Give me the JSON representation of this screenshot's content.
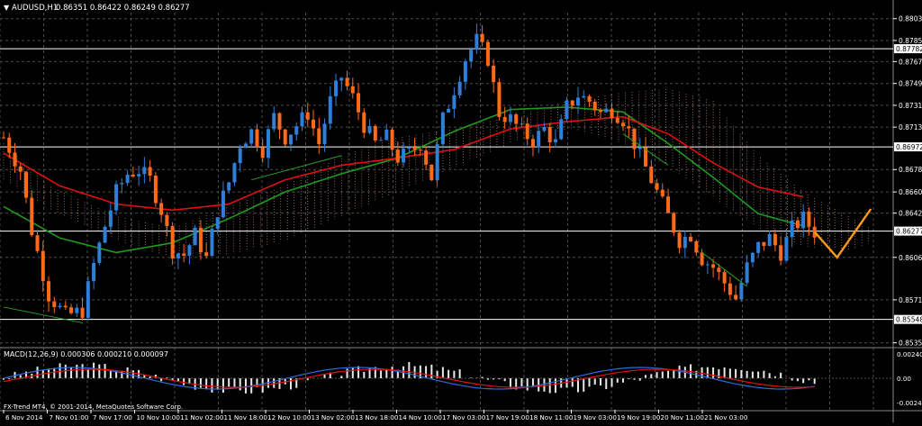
{
  "header": {
    "symbol": "AUDUSD,H1",
    "ohlc": "0.86351 0.86422 0.86249 0.86277"
  },
  "macd_header": {
    "label": "MACD(12,26,9) 0.000306 0.000210 0.000097"
  },
  "copyright": "FX-Trend MT4, © 2001-2014, MetaQuotes Software Corp.",
  "colors": {
    "background": "#000000",
    "grid": "#4a4a4a",
    "bull": "#2f7fd8",
    "bear": "#ff6a1a",
    "ma_red": "#e01010",
    "ma_green": "#1f9a1f",
    "cloud": "#e8b090",
    "trendline": "#2aa02a",
    "projection": "#ff9a1a",
    "text": "#ffffff"
  },
  "chart_data": [
    {
      "type": "candlestick",
      "title": "AUDUSD,H1",
      "ylim": [
        0.8533,
        0.8808
      ],
      "y_ticks": [
        "0.88030",
        "0.87850",
        "0.87676",
        "0.87495",
        "0.87315",
        "0.87135",
        "0.86785",
        "0.86600",
        "0.86425",
        "0.86060",
        "0.85710",
        "0.85355"
      ],
      "x_ticks": [
        "6 Nov 2014",
        "7 Nov 01:00",
        "7 Nov 17:00",
        "10 Nov 10:00",
        "11 Nov 02:00",
        "11 Nov 18:00",
        "12 Nov 10:00",
        "13 Nov 02:00",
        "13 Nov 18:00",
        "14 Nov 10:00",
        "17 Nov 03:00",
        "17 Nov 19:00",
        "18 Nov 11:00",
        "19 Nov 03:00",
        "19 Nov 19:00",
        "20 Nov 11:00",
        "21 Nov 03:00"
      ],
      "horizontal_levels": [
        "0.87782",
        "0.86972",
        "0.86277",
        "0.85548"
      ],
      "close_path": [
        [
          0,
          0.8705
        ],
        [
          3,
          0.8678
        ],
        [
          5,
          0.8628
        ],
        [
          8,
          0.8575
        ],
        [
          11,
          0.8558
        ],
        [
          14,
          0.8562
        ],
        [
          16,
          0.86
        ],
        [
          18,
          0.8632
        ],
        [
          20,
          0.866
        ],
        [
          22,
          0.8675
        ],
        [
          24,
          0.8678
        ],
        [
          26,
          0.867
        ],
        [
          28,
          0.8645
        ],
        [
          30,
          0.8612
        ],
        [
          32,
          0.8608
        ],
        [
          34,
          0.8625
        ],
        [
          36,
          0.8605
        ],
        [
          38,
          0.8645
        ],
        [
          40,
          0.8668
        ],
        [
          42,
          0.87
        ],
        [
          44,
          0.871
        ],
        [
          46,
          0.8695
        ],
        [
          48,
          0.8722
        ],
        [
          50,
          0.8705
        ],
        [
          52,
          0.8715
        ],
        [
          54,
          0.8725
        ],
        [
          56,
          0.87
        ],
        [
          58,
          0.8735
        ],
        [
          60,
          0.8755
        ],
        [
          62,
          0.8738
        ],
        [
          64,
          0.8715
        ],
        [
          66,
          0.87
        ],
        [
          68,
          0.8705
        ],
        [
          70,
          0.8688
        ],
        [
          72,
          0.8692
        ],
        [
          74,
          0.87
        ],
        [
          76,
          0.8672
        ],
        [
          78,
          0.872
        ],
        [
          80,
          0.8745
        ],
        [
          82,
          0.877
        ],
        [
          84,
          0.8785
        ],
        [
          86,
          0.877
        ],
        [
          88,
          0.8725
        ],
        [
          90,
          0.872
        ],
        [
          92,
          0.871
        ],
        [
          94,
          0.8702
        ],
        [
          96,
          0.8712
        ],
        [
          98,
          0.87
        ],
        [
          100,
          0.873
        ],
        [
          102,
          0.874
        ],
        [
          104,
          0.8735
        ],
        [
          106,
          0.8725
        ],
        [
          108,
          0.8728
        ],
        [
          110,
          0.872
        ],
        [
          112,
          0.87
        ],
        [
          114,
          0.868
        ],
        [
          116,
          0.866
        ],
        [
          118,
          0.864
        ],
        [
          120,
          0.862
        ],
        [
          122,
          0.8625
        ],
        [
          124,
          0.8605
        ],
        [
          126,
          0.8598
        ],
        [
          128,
          0.8585
        ],
        [
          130,
          0.8572
        ],
        [
          132,
          0.8598
        ],
        [
          134,
          0.8615
        ],
        [
          136,
          0.8622
        ],
        [
          138,
          0.861
        ],
        [
          140,
          0.863
        ],
        [
          142,
          0.8638
        ],
        [
          144,
          0.8627
        ]
      ],
      "ma_red": [
        [
          0,
          0.8692
        ],
        [
          10,
          0.8665
        ],
        [
          20,
          0.865
        ],
        [
          30,
          0.8645
        ],
        [
          40,
          0.865
        ],
        [
          50,
          0.867
        ],
        [
          60,
          0.8682
        ],
        [
          70,
          0.8688
        ],
        [
          80,
          0.8695
        ],
        [
          90,
          0.8712
        ],
        [
          100,
          0.8718
        ],
        [
          110,
          0.8722
        ],
        [
          118,
          0.8708
        ],
        [
          126,
          0.8684
        ],
        [
          134,
          0.8664
        ],
        [
          142,
          0.8656
        ]
      ],
      "ma_green": [
        [
          0,
          0.8648
        ],
        [
          10,
          0.8622
        ],
        [
          20,
          0.861
        ],
        [
          30,
          0.8618
        ],
        [
          40,
          0.8638
        ],
        [
          50,
          0.866
        ],
        [
          60,
          0.8675
        ],
        [
          70,
          0.8688
        ],
        [
          80,
          0.871
        ],
        [
          90,
          0.8728
        ],
        [
          100,
          0.873
        ],
        [
          110,
          0.8726
        ],
        [
          118,
          0.87
        ],
        [
          126,
          0.8672
        ],
        [
          134,
          0.8642
        ],
        [
          142,
          0.8632
        ]
      ],
      "projection": [
        [
          144,
          0.8627
        ],
        [
          148,
          0.8606
        ],
        [
          154,
          0.8646
        ]
      ]
    },
    {
      "type": "bar",
      "title": "MACD(12,26,9)",
      "ylim": [
        -0.00044,
        0.00044
      ],
      "y_ticks": [
        "0.002407",
        "0.00",
        "-0.002463"
      ]
    }
  ]
}
